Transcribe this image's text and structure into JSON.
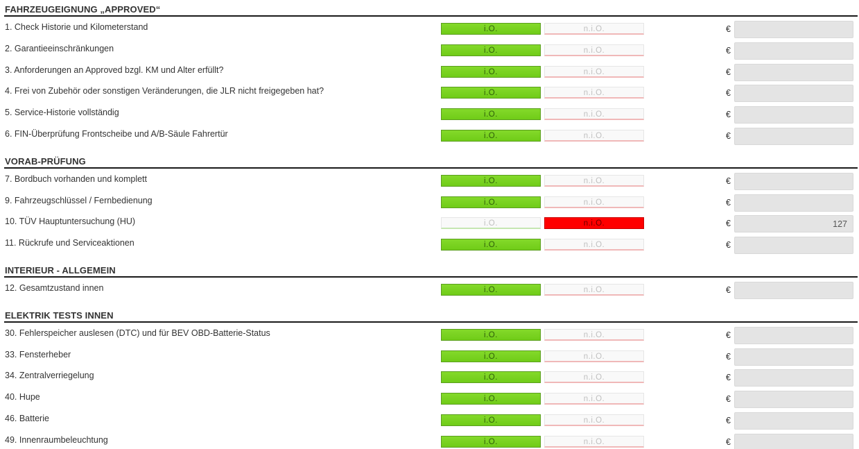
{
  "io_label": "i.O.",
  "nio_label": "n.i.O.",
  "currency": "€",
  "colors": {
    "io_active": "#7ed321",
    "nio_active": "#ff0000",
    "price_bg": "#e4e4e4"
  },
  "sections": [
    {
      "title": "FAHRZEUGEIGNUNG „APPROVED“",
      "items": [
        {
          "label": "1. Check Historie und Kilometerstand",
          "status": "io",
          "price": ""
        },
        {
          "label": "2. Garantieeinschränkungen",
          "status": "io",
          "price": ""
        },
        {
          "label": "3. Anforderungen an Approved bzgl. KM und Alter erfüllt?",
          "status": "io",
          "price": ""
        },
        {
          "label": "4. Frei von Zubehör oder sonstigen Veränderungen, die JLR nicht freigegeben hat?",
          "status": "io",
          "price": ""
        },
        {
          "label": "5. Service-Historie vollständig",
          "status": "io",
          "price": ""
        },
        {
          "label": "6. FIN-Überprüfung Frontscheibe und A/B-Säule Fahrertür",
          "status": "io",
          "price": ""
        }
      ]
    },
    {
      "title": "VORAB-PRÜFUNG",
      "items": [
        {
          "label": "7. Bordbuch vorhanden und komplett",
          "status": "io",
          "price": ""
        },
        {
          "label": "9. Fahrzeugschlüssel / Fernbedienung",
          "status": "io",
          "price": ""
        },
        {
          "label": "10. TÜV Hauptuntersuchung (HU)",
          "status": "nio",
          "price": "127"
        },
        {
          "label": "11. Rückrufe und Serviceaktionen",
          "status": "io",
          "price": ""
        }
      ]
    },
    {
      "title": "INTERIEUR - ALLGEMEIN",
      "items": [
        {
          "label": "12. Gesamtzustand innen",
          "status": "io",
          "price": ""
        }
      ]
    },
    {
      "title": "ELEKTRIK TESTS INNEN",
      "items": [
        {
          "label": "30. Fehlerspeicher auslesen (DTC) und für BEV OBD-Batterie-Status",
          "status": "io",
          "price": ""
        },
        {
          "label": "33. Fensterheber",
          "status": "io",
          "price": ""
        },
        {
          "label": "34. Zentralverriegelung",
          "status": "io",
          "price": ""
        },
        {
          "label": "40. Hupe",
          "status": "io",
          "price": ""
        },
        {
          "label": "46. Batterie",
          "status": "io",
          "price": ""
        },
        {
          "label": "49. Innenraumbeleuchtung",
          "status": "io",
          "price": ""
        }
      ]
    }
  ]
}
